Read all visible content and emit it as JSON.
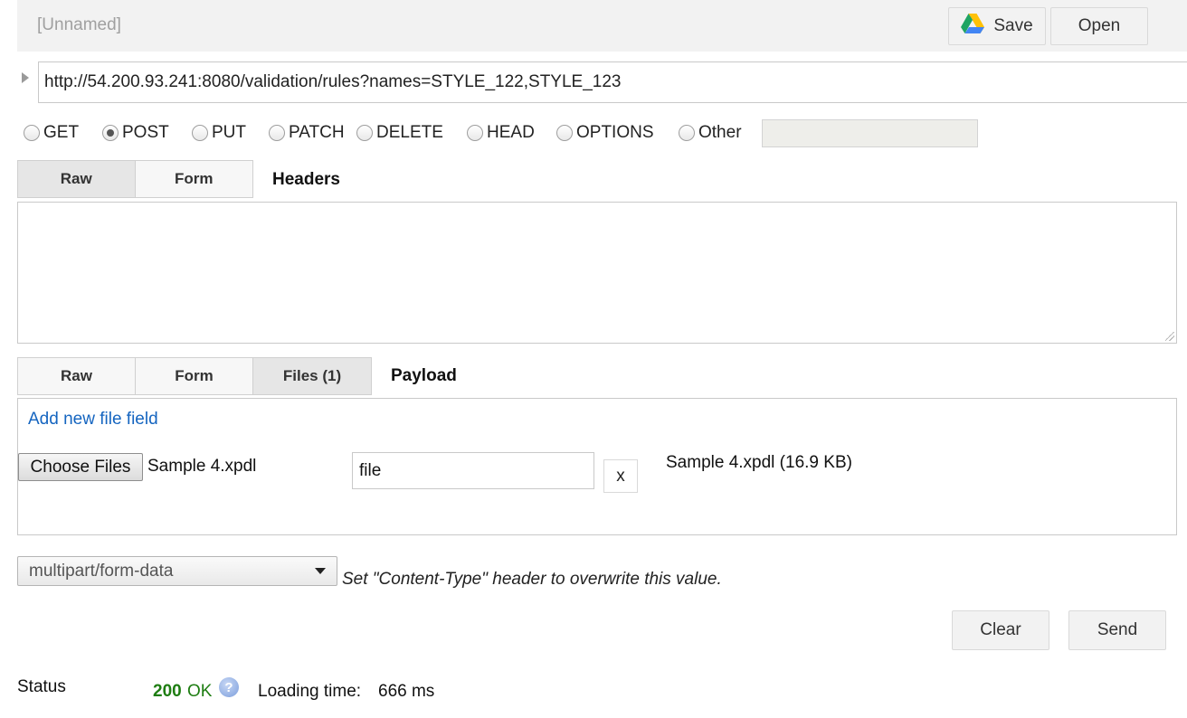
{
  "header": {
    "title": "[Unnamed]",
    "save_label": "Save",
    "open_label": "Open"
  },
  "request": {
    "url": "http://54.200.93.241:8080/validation/rules?names=STYLE_122,STYLE_123"
  },
  "methods": [
    {
      "label": "GET",
      "checked": false
    },
    {
      "label": "POST",
      "checked": true
    },
    {
      "label": "PUT",
      "checked": false
    },
    {
      "label": "PATCH",
      "checked": false
    },
    {
      "label": "DELETE",
      "checked": false
    },
    {
      "label": "HEAD",
      "checked": false
    },
    {
      "label": "OPTIONS",
      "checked": false
    },
    {
      "label": "Other",
      "checked": false
    }
  ],
  "headers_section": {
    "tabs": [
      "Raw",
      "Form"
    ],
    "active_tab": "Raw",
    "label": "Headers",
    "value": ""
  },
  "payload_section": {
    "tabs": [
      "Raw",
      "Form",
      "Files (1)"
    ],
    "active_tab": "Files (1)",
    "label": "Payload",
    "add_file_link": "Add new file field",
    "choose_files_label": "Choose Files",
    "chosen_file": "Sample 4.xpdl",
    "field_name": "file",
    "remove_label": "x",
    "file_info": "Sample 4.xpdl (16.9 KB)"
  },
  "content_type": {
    "selected": "multipart/form-data",
    "note": "Set \"Content-Type\" header to overwrite this value."
  },
  "actions": {
    "clear_label": "Clear",
    "send_label": "Send"
  },
  "response": {
    "status_label": "Status",
    "status_code": "200",
    "status_text": "OK",
    "loading_label": "Loading time:",
    "loading_value": "666 ms"
  },
  "icons": {
    "drive": "google-drive-icon",
    "help": "help-icon"
  },
  "colors": {
    "status_ok": "#1e7d12",
    "link": "#1565c0"
  }
}
